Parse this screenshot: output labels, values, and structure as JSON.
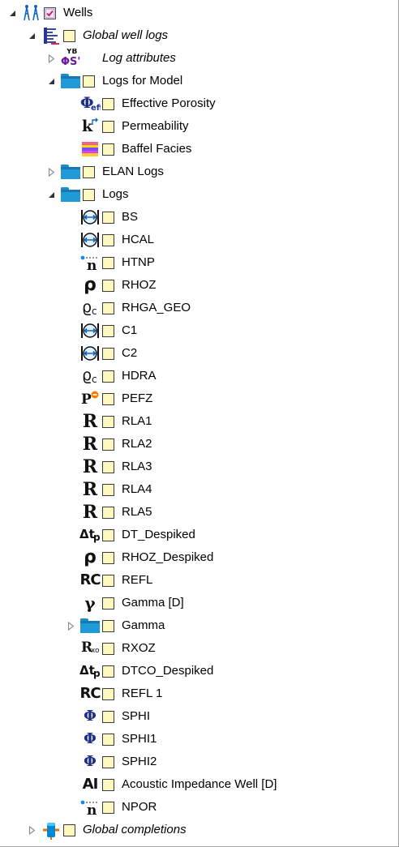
{
  "tree": [
    {
      "label": "Wells",
      "italic": false,
      "indent": 0,
      "expander": "expanded",
      "icon": "wells-icon",
      "checkbox": "checked"
    },
    {
      "label": "Global well logs",
      "italic": true,
      "indent": 1,
      "expander": "expanded",
      "icon": "global-logs-icon",
      "checkbox": "unchecked"
    },
    {
      "label": "Log attributes",
      "italic": true,
      "indent": 2,
      "expander": "collapsed",
      "icon": "log-attributes-icon",
      "checkbox": "none"
    },
    {
      "label": "Logs for Model",
      "italic": false,
      "indent": 2,
      "expander": "expanded",
      "icon": "folder-icon",
      "checkbox": "unchecked"
    },
    {
      "label": "Effective Porosity",
      "italic": false,
      "indent": 3,
      "expander": "none",
      "icon": "effective-porosity-icon",
      "checkbox": "unchecked"
    },
    {
      "label": "Permeability",
      "italic": false,
      "indent": 3,
      "expander": "none",
      "icon": "permeability-icon",
      "checkbox": "unchecked"
    },
    {
      "label": "Baffel Facies",
      "italic": false,
      "indent": 3,
      "expander": "none",
      "icon": "facies-icon",
      "checkbox": "unchecked"
    },
    {
      "label": "ELAN Logs",
      "italic": false,
      "indent": 2,
      "expander": "collapsed",
      "icon": "folder-icon",
      "checkbox": "unchecked"
    },
    {
      "label": "Logs",
      "italic": false,
      "indent": 2,
      "expander": "expanded",
      "icon": "folder-icon",
      "checkbox": "unchecked"
    },
    {
      "label": "BS",
      "italic": false,
      "indent": 3,
      "expander": "none",
      "icon": "caliper-icon",
      "checkbox": "unchecked"
    },
    {
      "label": "HCAL",
      "italic": false,
      "indent": 3,
      "expander": "none",
      "icon": "caliper-icon",
      "checkbox": "unchecked"
    },
    {
      "label": "HTNP",
      "italic": false,
      "indent": 3,
      "expander": "none",
      "icon": "neutron-icon",
      "checkbox": "unchecked"
    },
    {
      "label": "RHOZ",
      "italic": false,
      "indent": 3,
      "expander": "none",
      "icon": "density-icon",
      "checkbox": "unchecked"
    },
    {
      "label": "RHGA_GEO",
      "italic": false,
      "indent": 3,
      "expander": "none",
      "icon": "density-correction-icon",
      "checkbox": "unchecked"
    },
    {
      "label": "C1",
      "italic": false,
      "indent": 3,
      "expander": "none",
      "icon": "caliper-icon",
      "checkbox": "unchecked"
    },
    {
      "label": "C2",
      "italic": false,
      "indent": 3,
      "expander": "none",
      "icon": "caliper-icon",
      "checkbox": "unchecked"
    },
    {
      "label": "HDRA",
      "italic": false,
      "indent": 3,
      "expander": "none",
      "icon": "density-correction-icon",
      "checkbox": "unchecked"
    },
    {
      "label": "PEFZ",
      "italic": false,
      "indent": 3,
      "expander": "none",
      "icon": "photoelectric-icon",
      "checkbox": "unchecked"
    },
    {
      "label": "RLA1",
      "italic": false,
      "indent": 3,
      "expander": "none",
      "icon": "resistivity-icon",
      "checkbox": "unchecked"
    },
    {
      "label": "RLA2",
      "italic": false,
      "indent": 3,
      "expander": "none",
      "icon": "resistivity-icon",
      "checkbox": "unchecked"
    },
    {
      "label": "RLA3",
      "italic": false,
      "indent": 3,
      "expander": "none",
      "icon": "resistivity-icon",
      "checkbox": "unchecked"
    },
    {
      "label": "RLA4",
      "italic": false,
      "indent": 3,
      "expander": "none",
      "icon": "resistivity-icon",
      "checkbox": "unchecked"
    },
    {
      "label": "RLA5",
      "italic": false,
      "indent": 3,
      "expander": "none",
      "icon": "resistivity-icon",
      "checkbox": "unchecked"
    },
    {
      "label": "DT_Despiked",
      "italic": false,
      "indent": 3,
      "expander": "none",
      "icon": "sonic-icon",
      "checkbox": "unchecked"
    },
    {
      "label": "RHOZ_Despiked",
      "italic": false,
      "indent": 3,
      "expander": "none",
      "icon": "density-icon",
      "checkbox": "unchecked"
    },
    {
      "label": "REFL",
      "italic": false,
      "indent": 3,
      "expander": "none",
      "icon": "reflection-coefficient-icon",
      "checkbox": "unchecked"
    },
    {
      "label": "Gamma [D]",
      "italic": false,
      "indent": 3,
      "expander": "none",
      "icon": "gamma-icon",
      "checkbox": "unchecked"
    },
    {
      "label": "Gamma",
      "italic": false,
      "indent": 3,
      "expander": "collapsed",
      "icon": "folder-icon",
      "checkbox": "unchecked"
    },
    {
      "label": "RXOZ",
      "italic": false,
      "indent": 3,
      "expander": "none",
      "icon": "flushed-resistivity-icon",
      "checkbox": "unchecked"
    },
    {
      "label": "DTCO_Despiked",
      "italic": false,
      "indent": 3,
      "expander": "none",
      "icon": "sonic-icon",
      "checkbox": "unchecked"
    },
    {
      "label": "REFL 1",
      "italic": false,
      "indent": 3,
      "expander": "none",
      "icon": "reflection-coefficient-icon",
      "checkbox": "unchecked"
    },
    {
      "label": "SPHI",
      "italic": false,
      "indent": 3,
      "expander": "none",
      "icon": "porosity-icon",
      "checkbox": "unchecked"
    },
    {
      "label": "SPHI1",
      "italic": false,
      "indent": 3,
      "expander": "none",
      "icon": "porosity-icon",
      "checkbox": "unchecked"
    },
    {
      "label": "SPHI2",
      "italic": false,
      "indent": 3,
      "expander": "none",
      "icon": "porosity-icon",
      "checkbox": "unchecked"
    },
    {
      "label": "Acoustic Impedance Well [D]",
      "italic": false,
      "indent": 3,
      "expander": "none",
      "icon": "acoustic-impedance-icon",
      "checkbox": "unchecked"
    },
    {
      "label": "NPOR",
      "italic": false,
      "indent": 3,
      "expander": "none",
      "icon": "neutron-icon",
      "checkbox": "unchecked"
    },
    {
      "label": "Global completions",
      "italic": true,
      "indent": 1,
      "expander": "collapsed",
      "icon": "completions-icon",
      "checkbox": "unchecked"
    }
  ],
  "icon_text": {
    "log_attributes_top": "YB",
    "log_attributes_bottom": "ΦS'",
    "effective_porosity": "Φ",
    "effective_porosity_sub": "eff",
    "permeability": "k",
    "neutron": "n",
    "density": "ρ",
    "density_correction": "ϱ",
    "density_correction_sub": "c",
    "photoelectric": "P",
    "resistivity": "R",
    "flushed_resistivity": "R",
    "flushed_resistivity_sub": "xo",
    "sonic": "Δt",
    "sonic_sub": "p",
    "reflection_coefficient": "RC",
    "gamma": "γ",
    "porosity": "Φ",
    "acoustic_impedance": "AI"
  },
  "colors": {
    "checkbox_fill": "#fdf7c0",
    "checkbox_border": "#3a3a3a",
    "folder_blue": "#1f9ad6",
    "check_pink": "#c2185b",
    "wells_blue": "#1565c0"
  }
}
